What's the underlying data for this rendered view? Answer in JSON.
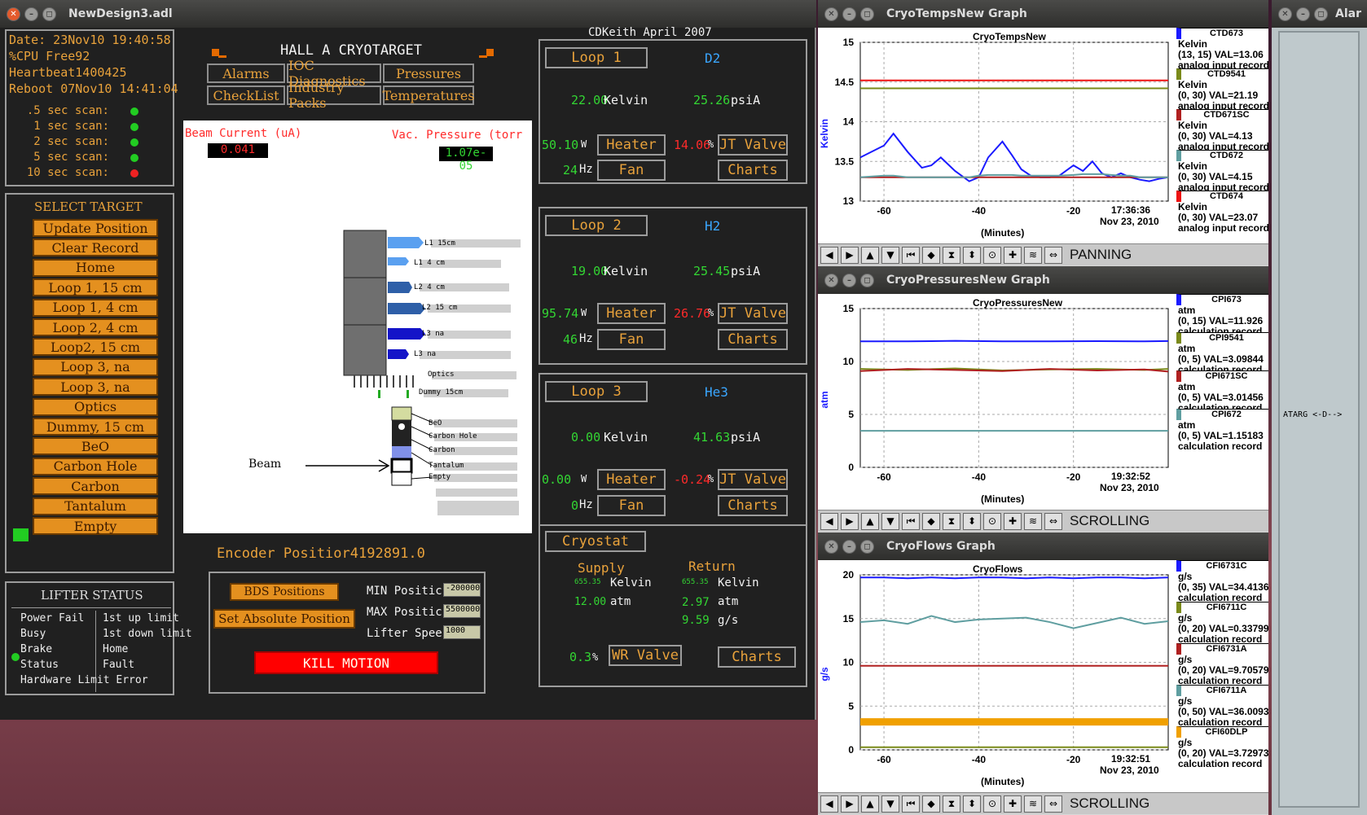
{
  "main_window": {
    "title": "NewDesign3.adl",
    "status": {
      "date": "Date: 23Nov10 19:40:58",
      "cpu": "%CPU Free92",
      "heartbeat": "Heartbeat1400425",
      "reboot": "Reboot 07Nov10 14:41:04",
      "scans": [
        {
          "label": ".5 sec scan:",
          "color": "#22cc22"
        },
        {
          "label": "1 sec scan:",
          "color": "#22cc22"
        },
        {
          "label": "2 sec scan:",
          "color": "#22cc22"
        },
        {
          "label": "5 sec scan:",
          "color": "#22cc22"
        },
        {
          "label": "10 sec scan:",
          "color": "#ee2222"
        }
      ]
    },
    "header": {
      "title": "HALL A CRYOTARGET",
      "author": "CDKeith April 2007",
      "nav": [
        "Alarms",
        "IOC Diagnostics",
        "Pressures",
        "CheckList",
        "Industry Packs",
        "Temperatures"
      ]
    },
    "select_target": {
      "title": "SELECT TARGET",
      "buttons": [
        "Update Position",
        "Clear Record",
        "Home",
        "Loop 1, 15 cm",
        "Loop 1, 4 cm",
        "Loop 2, 4 cm",
        "Loop2, 15 cm",
        "Loop 3, na",
        "Loop 3, na",
        "Optics",
        "Dummy, 15 cm",
        "BeO",
        "Carbon Hole",
        "Carbon",
        "Tantalum",
        "Empty"
      ]
    },
    "target_view": {
      "beam_current_label": "Beam Current (uA)",
      "beam_current": "0.041",
      "vac_pressure_label": "Vac. Pressure (torr",
      "vac_pressure": "1.07e-05",
      "cells": [
        "L1 15cm",
        "L1 4 cm",
        "L2 4 cm",
        "L2 15 cm",
        "L3 na",
        "L3 na",
        "Optics",
        "Dummy 15cm"
      ],
      "solids": [
        "BeO",
        "Carbon Hole",
        "Carbon",
        "Tantalum",
        "Empty"
      ],
      "beam_label": "Beam"
    },
    "encoder": "Encoder Positior4192891.0",
    "lifter": {
      "title": "LIFTER STATUS",
      "left": [
        "Power Fail",
        "Busy",
        "Brake",
        "Status",
        "Hardware Limit Error"
      ],
      "right": [
        "1st up limit",
        "1st down limit",
        "Home",
        "Fault"
      ]
    },
    "motion": {
      "bds_label": "BDS Positions",
      "abs_label": "Set Absolute Position",
      "kill_label": "KILL MOTION",
      "min_label": "MIN Positic",
      "min_value": "-200000",
      "max_label": "MAX Positic",
      "max_value": "5500000",
      "speed_label": "Lifter Spee",
      "speed_value": "1000"
    },
    "loops": [
      {
        "name": "Loop 1",
        "gas": "D2",
        "kelvin": "22.00",
        "psia": "25.26",
        "heater_w": "50.10",
        "jt_pct": "14.06",
        "fan_hz": "24",
        "jt_color": "#ff2a2a"
      },
      {
        "name": "Loop 2",
        "gas": "H2",
        "kelvin": "19.00",
        "psia": "25.45",
        "heater_w": "95.74",
        "jt_pct": "26.76",
        "fan_hz": "46",
        "jt_color": "#ff2a2a"
      },
      {
        "name": "Loop 3",
        "gas": "He3",
        "kelvin": "0.00",
        "psia": "41.63",
        "heater_w": "0.00",
        "jt_pct": "-0.24",
        "fan_hz": "0",
        "jt_color": "#ff2a2a"
      }
    ],
    "loop_units": {
      "kelvin": "Kelvin",
      "psia": "psiA",
      "w": "W",
      "pct": "%",
      "hz": "Hz"
    },
    "loop_buttons": {
      "heater": "Heater",
      "jt": "JT Valve",
      "fan": "Fan",
      "charts": "Charts"
    },
    "cryostat": {
      "title": "Cryostat",
      "supply": "Supply",
      "return": "Return",
      "supply_k": "655.35",
      "return_k": "655.35",
      "kelvin": "Kelvin",
      "supply_atm": "12.00",
      "return_atm": "2.97",
      "atm": "atm",
      "return_gs": "9.59",
      "gs": "g/s",
      "wr_pct": "0.3",
      "pct": "%",
      "wr_label": "WR Valve",
      "charts": "Charts"
    }
  },
  "graphs": [
    {
      "window_title": "CryoTempsNew Graph",
      "plot_title": "CryoTempsNew",
      "ylabel": "Kelvin",
      "xlabel": "(Minutes)",
      "time": "17:36:36",
      "date": "Nov 23, 2010",
      "yticks": [
        "15",
        "14.5",
        "14",
        "13.5",
        "13"
      ],
      "xticks": [
        "-60",
        "-40",
        "-20"
      ],
      "mode": "PANNING",
      "legend": [
        {
          "name": "CTD673",
          "color": "#1a1aff",
          "unit": "Kelvin",
          "val": "(13, 15) VAL=13.06",
          "kind": "analog input record"
        },
        {
          "name": "CTD9541",
          "color": "#7a8a1a",
          "unit": "Kelvin",
          "val": "(0, 30) VAL=21.19",
          "kind": "analog input record"
        },
        {
          "name": "CTD671SC",
          "color": "#b02020",
          "unit": "Kelvin",
          "val": "(0, 30) VAL=4.13",
          "kind": "analog input record"
        },
        {
          "name": "CTD672",
          "color": "#5f9ea0",
          "unit": "Kelvin",
          "val": "(0, 30) VAL=4.15",
          "kind": "analog input record"
        },
        {
          "name": "CTD674",
          "color": "#ee1111",
          "unit": "Kelvin",
          "val": "(0, 30) VAL=23.07",
          "kind": "analog input record"
        }
      ]
    },
    {
      "window_title": "CryoPressuresNew Graph",
      "plot_title": "CryoPressuresNew",
      "ylabel": "atm",
      "xlabel": "(Minutes)",
      "time": "19:32:52",
      "date": "Nov 23, 2010",
      "yticks": [
        "15",
        "10",
        "5",
        "0"
      ],
      "xticks": [
        "-60",
        "-40",
        "-20"
      ],
      "mode": "SCROLLING",
      "legend": [
        {
          "name": "CPI673",
          "color": "#1a1aff",
          "unit": "atm",
          "val": "(0, 15) VAL=11.926",
          "kind": "calculation record"
        },
        {
          "name": "CPI9541",
          "color": "#7a8a1a",
          "unit": "atm",
          "val": "(0, 5) VAL=3.09844",
          "kind": "calculation record"
        },
        {
          "name": "CPI671SC",
          "color": "#b02020",
          "unit": "atm",
          "val": "(0, 5) VAL=3.01456",
          "kind": "calculation record"
        },
        {
          "name": "CPI672",
          "color": "#5f9ea0",
          "unit": "atm",
          "val": "(0, 5) VAL=1.15183",
          "kind": "calculation record"
        }
      ]
    },
    {
      "window_title": "CryoFlows Graph",
      "plot_title": "CryoFlows",
      "ylabel": "g/s",
      "xlabel": "(Minutes)",
      "time": "19:32:51",
      "date": "Nov 23, 2010",
      "yticks": [
        "20",
        "15",
        "10",
        "5",
        "0"
      ],
      "xticks": [
        "-60",
        "-40",
        "-20"
      ],
      "mode": "SCROLLING",
      "legend": [
        {
          "name": "CFI6731C",
          "color": "#1a1aff",
          "unit": "g/s",
          "val": "(0, 35) VAL=34.4136",
          "kind": "calculation record"
        },
        {
          "name": "CFI6711C",
          "color": "#7a8a1a",
          "unit": "g/s",
          "val": "(0, 20) VAL=0.337997",
          "kind": "calculation record"
        },
        {
          "name": "CFI6731A",
          "color": "#b02020",
          "unit": "g/s",
          "val": "(0, 20) VAL=9.70579",
          "kind": "calculation record"
        },
        {
          "name": "CFI6711A",
          "color": "#5f9ea0",
          "unit": "g/s",
          "val": "(0, 50) VAL=36.0093",
          "kind": "calculation record"
        },
        {
          "name": "CFI60DLP",
          "color": "#f0a000",
          "unit": "g/s",
          "val": "(0, 20) VAL=3.72973",
          "kind": "calculation record"
        }
      ]
    }
  ],
  "chart_data": [
    {
      "type": "line",
      "title": "CryoTempsNew",
      "ylabel": "Kelvin",
      "xlabel": "(Minutes)",
      "ylim": [
        13,
        15
      ],
      "xlim": [
        -65,
        0
      ],
      "x": [
        -65,
        -60,
        -58,
        -55,
        -52,
        -50,
        -48,
        -45,
        -42,
        -40,
        -38,
        -35,
        -33,
        -31,
        -29,
        -27,
        -25,
        -23,
        -20,
        -18,
        -16,
        -14,
        -12,
        -10,
        -8,
        -6,
        -4,
        -2,
        0
      ],
      "series": [
        {
          "name": "CTD673",
          "color": "#1a1aff",
          "values": [
            13.55,
            13.7,
            13.85,
            13.62,
            13.42,
            13.45,
            13.55,
            13.38,
            13.25,
            13.3,
            13.55,
            13.75,
            13.58,
            13.4,
            13.32,
            13.3,
            13.3,
            13.32,
            13.45,
            13.38,
            13.5,
            13.35,
            13.3,
            13.35,
            13.3,
            13.27,
            13.25,
            13.28,
            13.3
          ]
        },
        {
          "name": "CTD9541",
          "color": "#7a8a1a",
          "values": [
            14.42,
            14.42,
            14.42,
            14.42,
            14.42,
            14.42,
            14.42,
            14.42,
            14.42,
            14.42,
            14.42,
            14.42,
            14.42,
            14.42,
            14.42,
            14.42,
            14.42,
            14.42,
            14.42,
            14.42,
            14.42,
            14.42,
            14.42,
            14.42,
            14.42,
            14.42,
            14.42,
            14.42,
            14.42
          ]
        },
        {
          "name": "CTD671SC",
          "color": "#b02020",
          "values": [
            13.3,
            13.3,
            13.3,
            13.3,
            13.3,
            13.3,
            13.3,
            13.3,
            13.3,
            13.3,
            13.3,
            13.3,
            13.3,
            13.3,
            13.3,
            13.3,
            13.3,
            13.3,
            13.3,
            13.3,
            13.3,
            13.3,
            13.3,
            13.3,
            13.3,
            13.3,
            13.3,
            13.3,
            13.3
          ]
        },
        {
          "name": "CTD672",
          "color": "#5f9ea0",
          "values": [
            13.3,
            13.32,
            13.32,
            13.3,
            13.3,
            13.3,
            13.3,
            13.3,
            13.3,
            13.32,
            13.33,
            13.33,
            13.33,
            13.32,
            13.32,
            13.32,
            13.32,
            13.32,
            13.33,
            13.34,
            13.34,
            13.34,
            13.33,
            13.32,
            13.32,
            13.3,
            13.3,
            13.3,
            13.3
          ]
        },
        {
          "name": "CTD674",
          "color": "#ee1111",
          "values": [
            14.52,
            14.52,
            14.52,
            14.52,
            14.52,
            14.52,
            14.52,
            14.52,
            14.52,
            14.52,
            14.52,
            14.52,
            14.52,
            14.52,
            14.52,
            14.52,
            14.52,
            14.52,
            14.52,
            14.52,
            14.52,
            14.52,
            14.52,
            14.52,
            14.52,
            14.52,
            14.52,
            14.52,
            14.52
          ]
        }
      ]
    },
    {
      "type": "line",
      "title": "CryoPressuresNew",
      "ylabel": "atm",
      "xlabel": "(Minutes)",
      "ylim": [
        0,
        15
      ],
      "xlim": [
        -65,
        0
      ],
      "x": [
        -65,
        -55,
        -45,
        -35,
        -25,
        -15,
        -5,
        0
      ],
      "series": [
        {
          "name": "CPI673",
          "color": "#1a1aff",
          "values": [
            11.9,
            11.9,
            11.95,
            11.9,
            11.9,
            11.92,
            11.9,
            11.93
          ]
        },
        {
          "name": "CPI9541",
          "color": "#7a8a1a",
          "values": [
            9.3,
            9.2,
            9.35,
            9.15,
            9.25,
            9.3,
            9.2,
            9.3
          ]
        },
        {
          "name": "CPI671SC",
          "color": "#b02020",
          "values": [
            9.1,
            9.3,
            9.2,
            9.1,
            9.3,
            9.15,
            9.25,
            9.05
          ]
        },
        {
          "name": "CPI672",
          "color": "#5f9ea0",
          "values": [
            3.45,
            3.45,
            3.45,
            3.45,
            3.45,
            3.45,
            3.45,
            3.45
          ]
        }
      ]
    },
    {
      "type": "line",
      "title": "CryoFlows",
      "ylabel": "g/s",
      "xlabel": "(Minutes)",
      "ylim": [
        0,
        20
      ],
      "xlim": [
        -65,
        0
      ],
      "x": [
        -65,
        -60,
        -55,
        -50,
        -45,
        -40,
        -35,
        -30,
        -25,
        -20,
        -15,
        -10,
        -5,
        0
      ],
      "series": [
        {
          "name": "CFI6731C",
          "color": "#1a1aff",
          "values": [
            19.7,
            19.7,
            19.6,
            19.7,
            19.6,
            19.7,
            19.7,
            19.6,
            19.7,
            19.6,
            19.7,
            19.7,
            19.6,
            19.7
          ]
        },
        {
          "name": "CFI6711C",
          "color": "#7a8a1a",
          "values": [
            0.3,
            0.3,
            0.3,
            0.3,
            0.3,
            0.3,
            0.3,
            0.3,
            0.3,
            0.3,
            0.3,
            0.3,
            0.3,
            0.3
          ]
        },
        {
          "name": "CFI6731A",
          "color": "#b02020",
          "values": [
            9.6,
            9.6,
            9.6,
            9.6,
            9.6,
            9.6,
            9.6,
            9.6,
            9.6,
            9.6,
            9.6,
            9.6,
            9.6,
            9.6
          ]
        },
        {
          "name": "CFI6711A",
          "color": "#5f9ea0",
          "values": [
            14.6,
            14.8,
            14.4,
            15.3,
            14.6,
            14.9,
            15.0,
            15.1,
            14.6,
            13.9,
            14.5,
            15.1,
            14.4,
            14.7
          ]
        },
        {
          "name": "CFI60DLP",
          "color": "#f0a000",
          "values": [
            3.2,
            3.2,
            3.2,
            3.2,
            3.2,
            3.2,
            3.2,
            3.2,
            3.2,
            3.2,
            3.2,
            3.2,
            3.2,
            3.2
          ]
        }
      ]
    }
  ],
  "right_window": {
    "title": "Alar",
    "label": "ATARG <-D-->"
  }
}
